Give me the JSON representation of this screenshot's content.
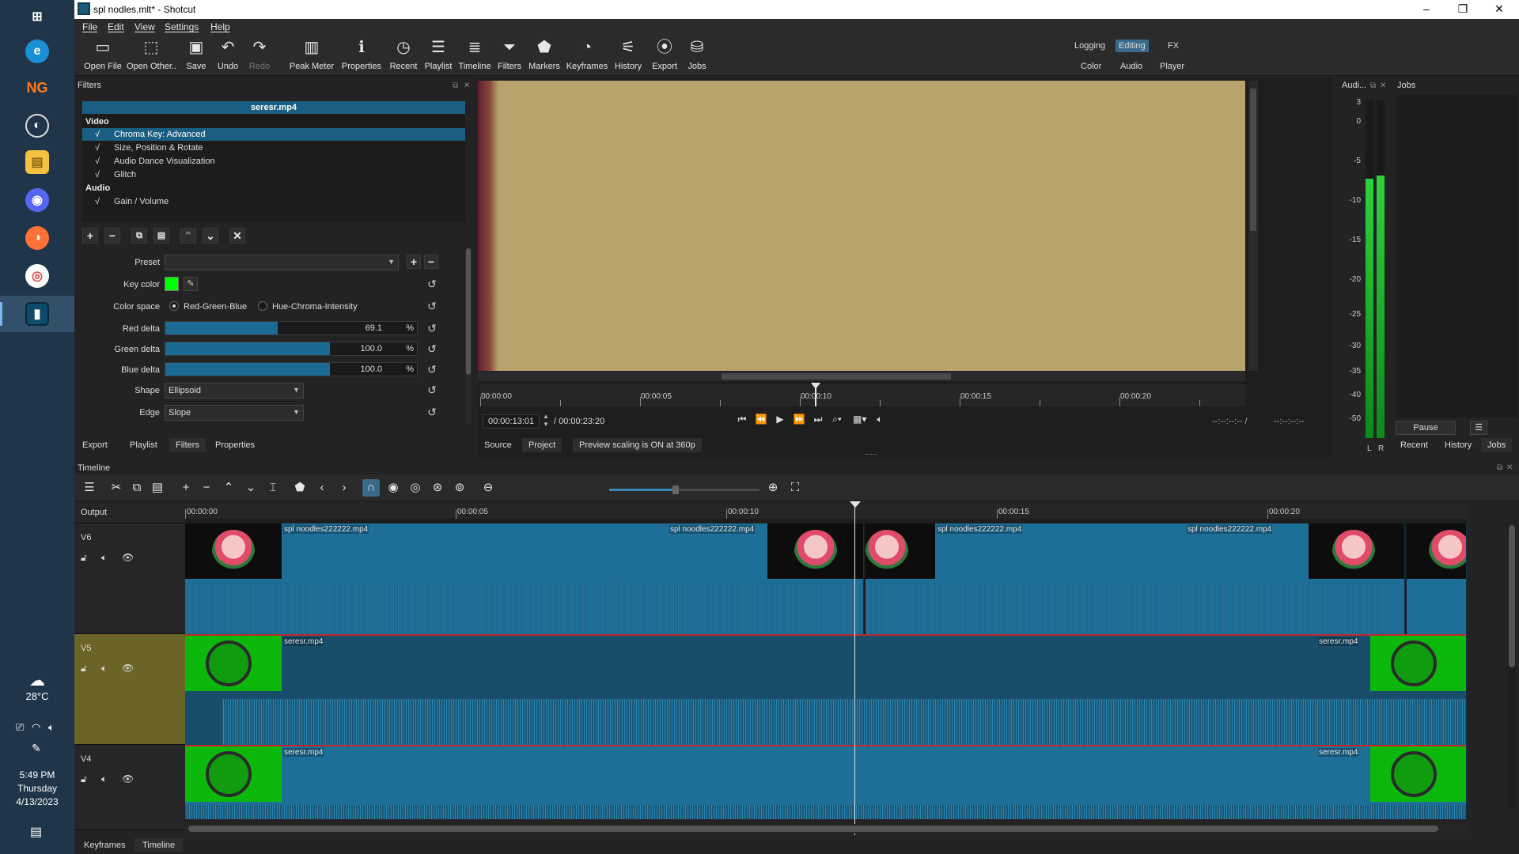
{
  "taskbar": {
    "weather_temp": "28°C",
    "clock_time": "5:49 PM",
    "clock_day": "Thursday",
    "clock_date": "4/13/2023",
    "app_icons": [
      "windows-start",
      "edge",
      "ng",
      "obs",
      "file-explorer",
      "discord",
      "firefox",
      "chrome",
      "shotcut"
    ]
  },
  "window": {
    "title": "spl nodles.mlt* - Shotcut",
    "minimize": "–",
    "maximize": "❐",
    "close": "✕"
  },
  "menu": [
    "File",
    "Edit",
    "View",
    "Settings",
    "Help"
  ],
  "toolbar": {
    "items": [
      {
        "label": "Open File",
        "icon": "folder-open-icon",
        "glyph": "▭"
      },
      {
        "label": "Open Other..",
        "icon": "open-other-icon",
        "glyph": "⬚"
      },
      {
        "label": "Save",
        "icon": "save-icon",
        "glyph": "▣"
      },
      {
        "label": "Undo",
        "icon": "undo-icon",
        "glyph": "↶"
      },
      {
        "label": "Redo",
        "icon": "redo-icon",
        "glyph": "↷"
      },
      {
        "label": "Peak Meter",
        "icon": "peak-meter-icon",
        "glyph": "▥"
      },
      {
        "label": "Properties",
        "icon": "properties-icon",
        "glyph": "ℹ"
      },
      {
        "label": "Recent",
        "icon": "recent-icon",
        "glyph": "◷"
      },
      {
        "label": "Playlist",
        "icon": "playlist-icon",
        "glyph": "☰"
      },
      {
        "label": "Timeline",
        "icon": "timeline-icon",
        "glyph": "≣"
      },
      {
        "label": "Filters",
        "icon": "filters-icon",
        "glyph": "⏷"
      },
      {
        "label": "Markers",
        "icon": "markers-icon",
        "glyph": "⬟"
      },
      {
        "label": "Keyframes",
        "icon": "keyframes-icon",
        "glyph": "◔"
      },
      {
        "label": "History",
        "icon": "history-icon",
        "glyph": "⚟"
      },
      {
        "label": "Export",
        "icon": "export-icon",
        "glyph": "⦿"
      },
      {
        "label": "Jobs",
        "icon": "jobs-icon",
        "glyph": "⛁"
      }
    ],
    "layouts_top": [
      "Logging",
      "Editing",
      "FX"
    ],
    "layouts_bottom": [
      "Color",
      "Audio",
      "Player"
    ],
    "active_layout": "Editing"
  },
  "filters_panel": {
    "title": "Filters",
    "clip_name": "seresr.mp4",
    "video_group": "Video",
    "video_filters": [
      "Chroma Key: Advanced",
      "Size, Position & Rotate",
      "Audio Dance Visualization",
      "Glitch"
    ],
    "audio_group": "Audio",
    "audio_filters": [
      "Gain / Volume"
    ],
    "check": "√",
    "preset_label": "Preset",
    "preset_value": "",
    "key_color_label": "Key color",
    "key_color": "#00ff00",
    "color_space_label": "Color space",
    "color_space_options": [
      "Red-Green-Blue",
      "Hue-Chroma-Intensity"
    ],
    "red_delta_label": "Red delta",
    "red_delta": "69.1",
    "green_delta_label": "Green delta",
    "green_delta": "100.0",
    "blue_delta_label": "Blue delta",
    "blue_delta": "100.0",
    "percent": "%",
    "shape_label": "Shape",
    "shape_value": "Ellipsoid",
    "edge_label": "Edge",
    "edge_value": "Slope",
    "tabs": [
      "Export",
      "Playlist",
      "Filters",
      "Properties"
    ],
    "active_tab": "Filters"
  },
  "viewer": {
    "ruler_labels": [
      "00:00:00",
      "00:00:05",
      "00:00:10",
      "00:00:15",
      "00:00:20"
    ],
    "current_time": "00:00:13:01",
    "duration": "/ 00:00:23:20",
    "in_point": "--:--:--:-- /",
    "out_point": "--:--:--:--",
    "tabs": [
      "Source",
      "Project"
    ],
    "active_tab": "Source",
    "status": "Preview scaling is ON at 360p"
  },
  "audio_meter": {
    "title": "Audi...",
    "scale": [
      "3",
      "0",
      "-5",
      "-10",
      "-15",
      "-20",
      "-25",
      "-30",
      "-35",
      "-40",
      "-50"
    ],
    "left_label": "L",
    "right_label": "R"
  },
  "jobs": {
    "title": "Jobs",
    "pause_label": "Pause",
    "menu_glyph": "☰",
    "tabs": [
      "Recent",
      "History",
      "Jobs"
    ],
    "active_tab": "Jobs"
  },
  "timeline": {
    "title": "Timeline",
    "ruler_labels": [
      "00:00:00",
      "00:00:05",
      "00:00:10",
      "00:00:15",
      "00:00:20"
    ],
    "tracks": [
      {
        "name": "Output"
      },
      {
        "name": "V6"
      },
      {
        "name": "V5"
      },
      {
        "name": "V4"
      }
    ],
    "v6_clip_name": "spl noodles222222.mp4",
    "v5_clip_name": "seresr.mp4",
    "v4_clip_name": "seresr.mp4"
  },
  "bottom_tabs": [
    "Keyframes",
    "Timeline"
  ],
  "active_bottom_tab": "Timeline"
}
